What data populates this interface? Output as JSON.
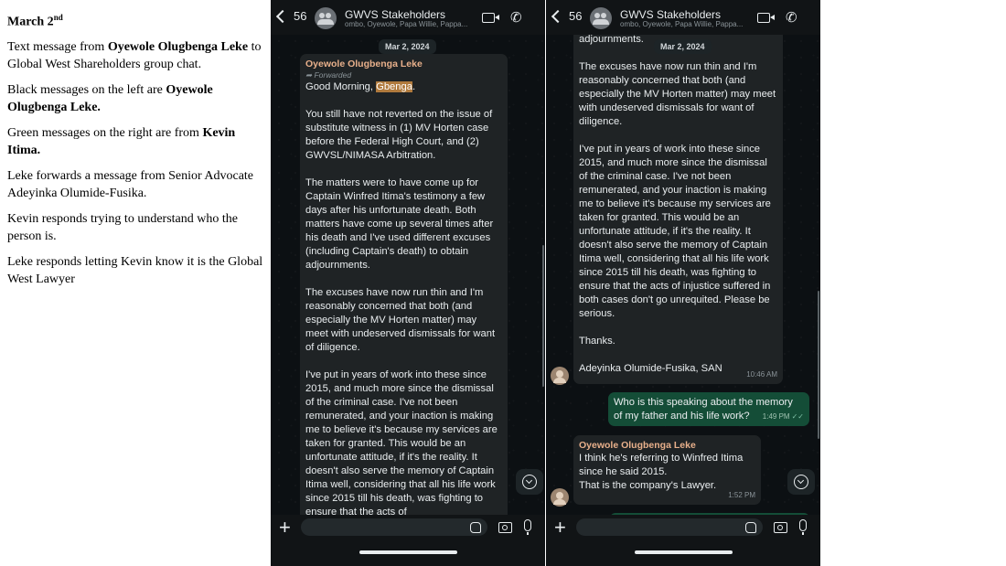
{
  "notes": {
    "date_main": "March 2",
    "date_suffix": "nd",
    "p1_pre": "Text message from ",
    "p1_bold": "Oyewole Olugbenga Leke",
    "p1_post": " to Global West Shareholders group chat.",
    "p2_pre": "Black messages on the left are ",
    "p2_bold": "Oyewole Olugbenga Leke.",
    "p3_pre": "Green messages on the right are from ",
    "p3_bold": "Kevin Itima.",
    "p4": "Leke forwards a message from Senior Advocate Adeyinka Olumide-Fusika.",
    "p5": "Kevin responds trying to understand who the person is.",
    "p6": "Leke responds letting Kevin know it is the Global West Lawyer"
  },
  "screen1": {
    "back_count": "56",
    "title": "GWVS Stakeholders",
    "subtitle": "ombo, Oyewole, Papa Willie, Pappa...",
    "date": "Mar 2, 2024",
    "msg": {
      "sender": "Oyewole Olugbenga Leke",
      "forwarded": "Forwarded",
      "greeting_pre": "Good Morning, ",
      "greeting_hl": "Gbenga",
      "greeting_post": ".",
      "body": "You still have not reverted on the issue of substitute witness in (1) MV Horten case before the Federal High Court, and (2) GWVSL/NIMASA Arbitration.\n\nThe matters were to have come up for Captain Winfred Itima's testimony a few days after his unfortunate death. Both matters have come up several times after his death and I've used different excuses (including Captain's death) to obtain adjournments.\n\nThe excuses have now run thin and I'm reasonably concerned that both (and especially the MV Horten matter) may meet with undeserved dismissals for want of diligence.\n\nI've put in years of work into these since 2015, and much more since the dismissal of the criminal case. I've not been remunerated, and your inaction is making me to believe it's because my services are taken for granted. This would be an unfortunate attitude, if it's the reality. It doesn't also serve the memory of Captain Itima well, considering that all his life work since 2015 till his death, was fighting to ensure that the acts of"
    }
  },
  "screen2": {
    "back_count": "56",
    "title": "GWVS Stakeholders",
    "subtitle": "ombo, Oyewole, Papa Willie, Pappa...",
    "date": "Mar 2, 2024",
    "msg1": {
      "top": "adjournments.",
      "body": "The excuses have now run thin and I'm reasonably concerned that both (and especially the MV Horten matter) may meet with undeserved dismissals for want of diligence.\n\nI've put in years of work into these since 2015, and much more since the dismissal of the criminal case. I've not been remunerated, and your inaction is making me to believe it's because my services are taken for granted. This would be an unfortunate attitude, if it's the reality. It doesn't also serve the memory of Captain Itima well, considering that all his life work since 2015 till his death, was fighting to ensure that the acts of injustice suffered in both cases don't go unrequited. Please be serious.\n\nThanks.",
      "signature": "Adeyinka Olumide-Fusika, SAN",
      "time": "10:46 AM"
    },
    "msg2": {
      "text": "Who is this speaking about the memory of my father and his life work?",
      "time": "1:49 PM",
      "ticks": "✓✓"
    },
    "msg3": {
      "sender": "Oyewole Olugbenga Leke",
      "text": "I think he's referring to Winfred Itima since he said 2015.\nThat is the company's Lawyer.",
      "time": "1:52 PM"
    }
  }
}
